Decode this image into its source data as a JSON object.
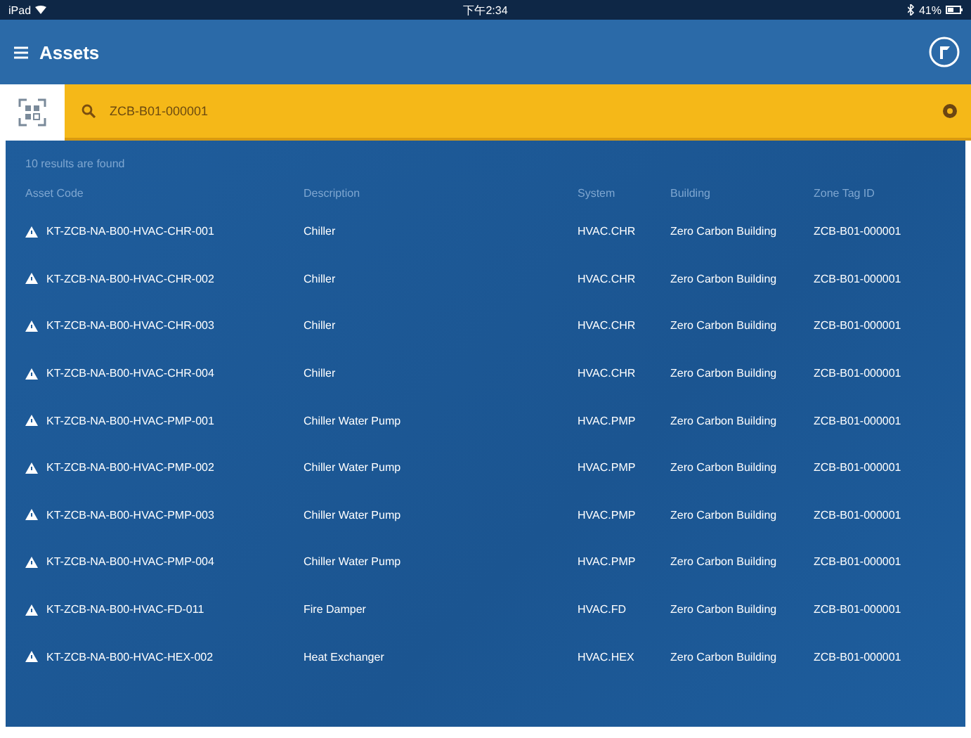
{
  "status_bar": {
    "carrier": "iPad",
    "time": "下午2:34",
    "battery": "41%"
  },
  "header": {
    "title": "Assets"
  },
  "search": {
    "value": "ZCB-B01-000001"
  },
  "results": {
    "summary": "10 results are found",
    "columns": [
      "Asset Code",
      "Description",
      "System",
      "Building",
      "Zone Tag ID"
    ],
    "rows": [
      {
        "code": "KT-ZCB-NA-B00-HVAC-CHR-001",
        "description": "Chiller",
        "system": "HVAC.CHR",
        "building": "Zero Carbon Building",
        "zone": "ZCB-B01-000001"
      },
      {
        "code": "KT-ZCB-NA-B00-HVAC-CHR-002",
        "description": "Chiller",
        "system": "HVAC.CHR",
        "building": "Zero Carbon Building",
        "zone": "ZCB-B01-000001"
      },
      {
        "code": "KT-ZCB-NA-B00-HVAC-CHR-003",
        "description": "Chiller",
        "system": "HVAC.CHR",
        "building": "Zero Carbon Building",
        "zone": "ZCB-B01-000001"
      },
      {
        "code": "KT-ZCB-NA-B00-HVAC-CHR-004",
        "description": "Chiller",
        "system": "HVAC.CHR",
        "building": "Zero Carbon Building",
        "zone": "ZCB-B01-000001"
      },
      {
        "code": "KT-ZCB-NA-B00-HVAC-PMP-001",
        "description": "Chiller Water Pump",
        "system": "HVAC.PMP",
        "building": "Zero Carbon Building",
        "zone": "ZCB-B01-000001"
      },
      {
        "code": "KT-ZCB-NA-B00-HVAC-PMP-002",
        "description": "Chiller Water Pump",
        "system": "HVAC.PMP",
        "building": "Zero Carbon Building",
        "zone": "ZCB-B01-000001"
      },
      {
        "code": "KT-ZCB-NA-B00-HVAC-PMP-003",
        "description": "Chiller Water Pump",
        "system": "HVAC.PMP",
        "building": "Zero Carbon Building",
        "zone": "ZCB-B01-000001"
      },
      {
        "code": "KT-ZCB-NA-B00-HVAC-PMP-004",
        "description": "Chiller Water Pump",
        "system": "HVAC.PMP",
        "building": "Zero Carbon Building",
        "zone": "ZCB-B01-000001"
      },
      {
        "code": "KT-ZCB-NA-B00-HVAC-FD-011",
        "description": "Fire Damper",
        "system": "HVAC.FD",
        "building": "Zero Carbon Building",
        "zone": "ZCB-B01-000001"
      },
      {
        "code": "KT-ZCB-NA-B00-HVAC-HEX-002",
        "description": "Heat Exchanger",
        "system": "HVAC.HEX",
        "building": "Zero Carbon Building",
        "zone": "ZCB-B01-000001"
      }
    ]
  }
}
